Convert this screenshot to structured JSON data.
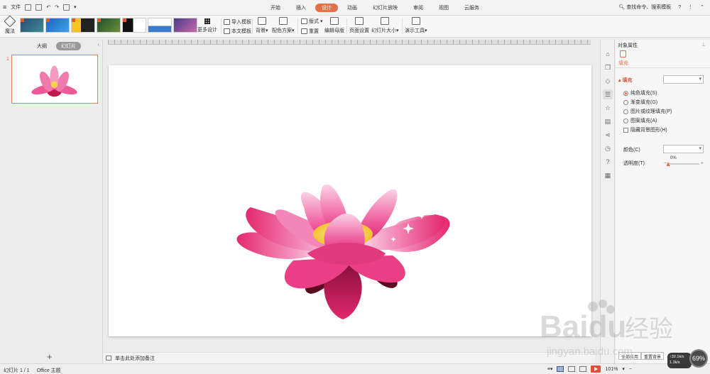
{
  "menubar": {
    "file_label": "文件",
    "tabs": [
      "开始",
      "插入",
      "设计",
      "动画",
      "幻灯片放映",
      "审阅",
      "视图",
      "云服务"
    ],
    "active_tab": "设计",
    "search_placeholder": "查找命令、搜索模板",
    "help": "?"
  },
  "ribbon": {
    "magic_label": "魔法",
    "more_design": "更多设计",
    "import_template": "导入模板",
    "this_template": "本文模板",
    "background": "背景",
    "color_scheme": "配色方案",
    "layout": "版式",
    "reset": "重置",
    "edit_master": "编辑母版",
    "page_setup": "页面设置",
    "slide_size": "幻灯片大小",
    "presenter_tools": "演示工具"
  },
  "left_panel": {
    "tab_outline": "大纲",
    "tab_slides": "幻灯片",
    "slide_number": "1",
    "add_label": "+"
  },
  "notes": {
    "placeholder": "单击此处添加备注"
  },
  "properties": {
    "title": "对象属性",
    "tab_fill": "填充",
    "section_fill": "填充",
    "options": [
      "纯色填充(S)",
      "渐变填充(G)",
      "图片或纹理填充(P)",
      "图案填充(A)"
    ],
    "selected_option": "纯色填充(S)",
    "hide_bg_graphics": "隐藏背景图形(H)",
    "color_label": "颜色(C)",
    "transparency_label": "透明度(T)",
    "transparency_value": "0%",
    "transparency_fraction": 0.0,
    "apply_all": "全部应用",
    "reset_bg": "重置背景"
  },
  "status": {
    "slide_counter": "幻灯片 1 / 1",
    "theme": "Office 主题",
    "zoom": "101%"
  },
  "network": {
    "up": "↑32.1k/s",
    "down": "1.3k/s",
    "percent": "69%"
  },
  "watermark": {
    "brand": "Baidu",
    "cn": "经验",
    "url": "jingyan.baidu.com"
  },
  "colors": {
    "accent": "#e2704a",
    "lotus_pink": "#e8357a",
    "lotus_light": "#f7b7d2"
  }
}
